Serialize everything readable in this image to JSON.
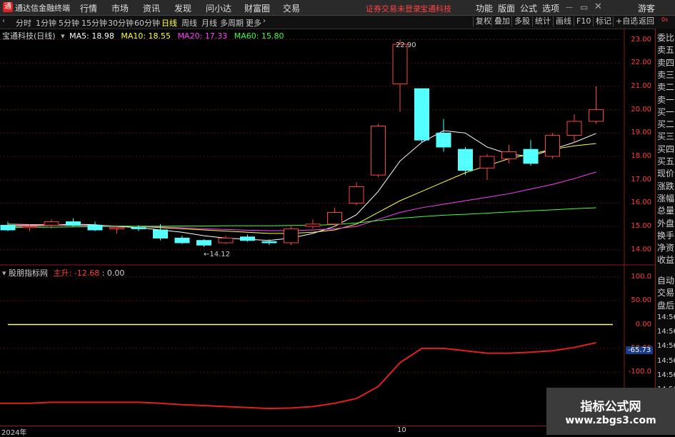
{
  "menu": {
    "logo": "通",
    "app_title": "通达信金融终端",
    "items": [
      "行情",
      "市场",
      "资讯",
      "发现",
      "问小达",
      "财富圈",
      "交易"
    ],
    "notice": "证券交易未登录",
    "stock_name": "宝通科技",
    "right_items": [
      "功能",
      "版面",
      "公式",
      "选项"
    ],
    "guest": "游客"
  },
  "toolbar": {
    "periods": [
      "分时",
      "1分钟",
      "5分钟",
      "15分钟",
      "30分钟",
      "60分钟",
      "日线",
      "周线",
      "月线",
      "多周期",
      "更多"
    ],
    "active": "日线",
    "right_buttons": [
      "复权",
      "叠加",
      "多股",
      "统计",
      "画线",
      "F10",
      "标记",
      "+自选",
      "返回"
    ]
  },
  "main_chart": {
    "title": "宝通科技(日线)",
    "ma": [
      {
        "label": "MA5: 18.98",
        "color": "#ffffff"
      },
      {
        "label": "MA10: 18.55",
        "color": "#ffff40"
      },
      {
        "label": "MA20: 17.33",
        "color": "#ff40ff"
      },
      {
        "label": "MA60: 15.80",
        "color": "#40ff40"
      }
    ],
    "high_label": "22.90",
    "low_label": "14.12",
    "y_ticks": [
      "23.00",
      "22.00",
      "21.00",
      "20.00",
      "19.00",
      "18.00",
      "17.00",
      "16.00",
      "15.00",
      "14.00"
    ],
    "candles": [
      [
        15.05,
        15.2,
        14.85,
        14.8
      ],
      [
        14.95,
        15.1,
        15.0,
        14.8
      ],
      [
        15.05,
        15.3,
        15.2,
        14.9
      ],
      [
        15.2,
        15.35,
        15.05,
        15.0
      ],
      [
        15.05,
        15.2,
        14.85,
        14.8
      ],
      [
        14.9,
        15.05,
        14.95,
        14.7
      ],
      [
        14.95,
        15.05,
        14.9,
        14.8
      ],
      [
        14.85,
        15.1,
        14.5,
        14.4
      ],
      [
        14.5,
        14.6,
        14.3,
        14.25
      ],
      [
        14.4,
        14.45,
        14.2,
        14.12
      ],
      [
        14.3,
        14.6,
        14.5,
        14.25
      ],
      [
        14.55,
        14.65,
        14.4,
        14.35
      ],
      [
        14.35,
        14.45,
        14.3,
        14.2
      ],
      [
        14.3,
        15.0,
        14.9,
        14.2
      ],
      [
        15.0,
        15.3,
        15.1,
        14.9
      ],
      [
        15.1,
        15.8,
        15.6,
        15.0
      ],
      [
        16.0,
        16.9,
        16.7,
        15.9
      ],
      [
        17.2,
        19.4,
        19.3,
        17.1
      ],
      [
        21.1,
        23.0,
        22.8,
        19.9
      ],
      [
        20.9,
        20.9,
        18.7,
        18.6
      ],
      [
        19.0,
        19.6,
        18.4,
        18.2
      ],
      [
        18.3,
        18.4,
        17.4,
        17.2
      ],
      [
        17.5,
        18.1,
        18.0,
        17.0
      ],
      [
        17.9,
        18.5,
        18.2,
        17.7
      ],
      [
        18.3,
        18.7,
        17.7,
        17.6
      ],
      [
        18.0,
        19.0,
        18.9,
        17.9
      ],
      [
        18.9,
        19.8,
        19.5,
        18.6
      ],
      [
        19.5,
        21.0,
        20.0,
        19.4
      ]
    ],
    "ma5": [
      15.0,
      15.02,
      15.05,
      15.1,
      15.07,
      15.0,
      14.95,
      14.85,
      14.75,
      14.6,
      14.5,
      14.45,
      14.4,
      14.5,
      14.7,
      15.0,
      15.5,
      16.5,
      17.8,
      18.6,
      19.1,
      19.0,
      18.4,
      18.1,
      18.0,
      18.3,
      18.6,
      18.98
    ],
    "ma10": [
      15.1,
      15.08,
      15.07,
      15.05,
      15.04,
      15.02,
      15.0,
      14.95,
      14.9,
      14.85,
      14.8,
      14.75,
      14.7,
      14.7,
      14.75,
      14.85,
      15.1,
      15.6,
      16.1,
      16.5,
      16.9,
      17.3,
      17.6,
      17.9,
      18.1,
      18.3,
      18.45,
      18.55
    ],
    "ma20": [
      15.05,
      15.05,
      15.05,
      15.04,
      15.03,
      15.02,
      15.0,
      14.98,
      14.95,
      14.9,
      14.87,
      14.84,
      14.82,
      14.82,
      14.85,
      14.9,
      15.0,
      15.3,
      15.6,
      15.8,
      15.95,
      16.1,
      16.25,
      16.4,
      16.6,
      16.8,
      17.05,
      17.33
    ],
    "ma60": [
      14.95,
      14.96,
      14.97,
      14.98,
      14.99,
      15.0,
      15.01,
      15.01,
      15.02,
      15.02,
      15.03,
      15.03,
      15.03,
      15.04,
      15.05,
      15.08,
      15.15,
      15.25,
      15.35,
      15.42,
      15.48,
      15.52,
      15.57,
      15.62,
      15.67,
      15.71,
      15.76,
      15.8
    ]
  },
  "indicator": {
    "title": "股朋指标网",
    "value_label": "主升: -12.68",
    "extra": ": 0.00",
    "current_tag": "-65.73",
    "y_ticks": [
      "100.0",
      "50.00",
      "0.00",
      "-50.00",
      "-100.0"
    ],
    "series": [
      -165,
      -165,
      -163,
      -163,
      -163,
      -163,
      -163,
      -165,
      -168,
      -170,
      -172,
      -174,
      -176,
      -175,
      -172,
      -165,
      -155,
      -130,
      -80,
      -50,
      -50,
      -55,
      -60,
      -60,
      -58,
      -55,
      -48,
      -38
    ]
  },
  "x_axis": {
    "labels": [
      "2024年",
      "10"
    ]
  },
  "right_panel": {
    "items": [
      "委比",
      "卖五",
      "卖四",
      "卖三",
      "卖二",
      "卖一",
      "买一",
      "买二",
      "买三",
      "买四",
      "买五",
      "现价",
      "涨跌",
      "涨幅",
      "总量",
      "外盘",
      "换手",
      "净资",
      "收益",
      "自动",
      "交易",
      "盘后",
      "14:56",
      "14:56",
      "14:56",
      "14:56",
      "14:56",
      "14:56",
      "14:56",
      "14:56"
    ],
    "top_icon": "0s"
  },
  "watermark": {
    "title": "指标公式网",
    "url": "www.zbgs3.com"
  }
}
